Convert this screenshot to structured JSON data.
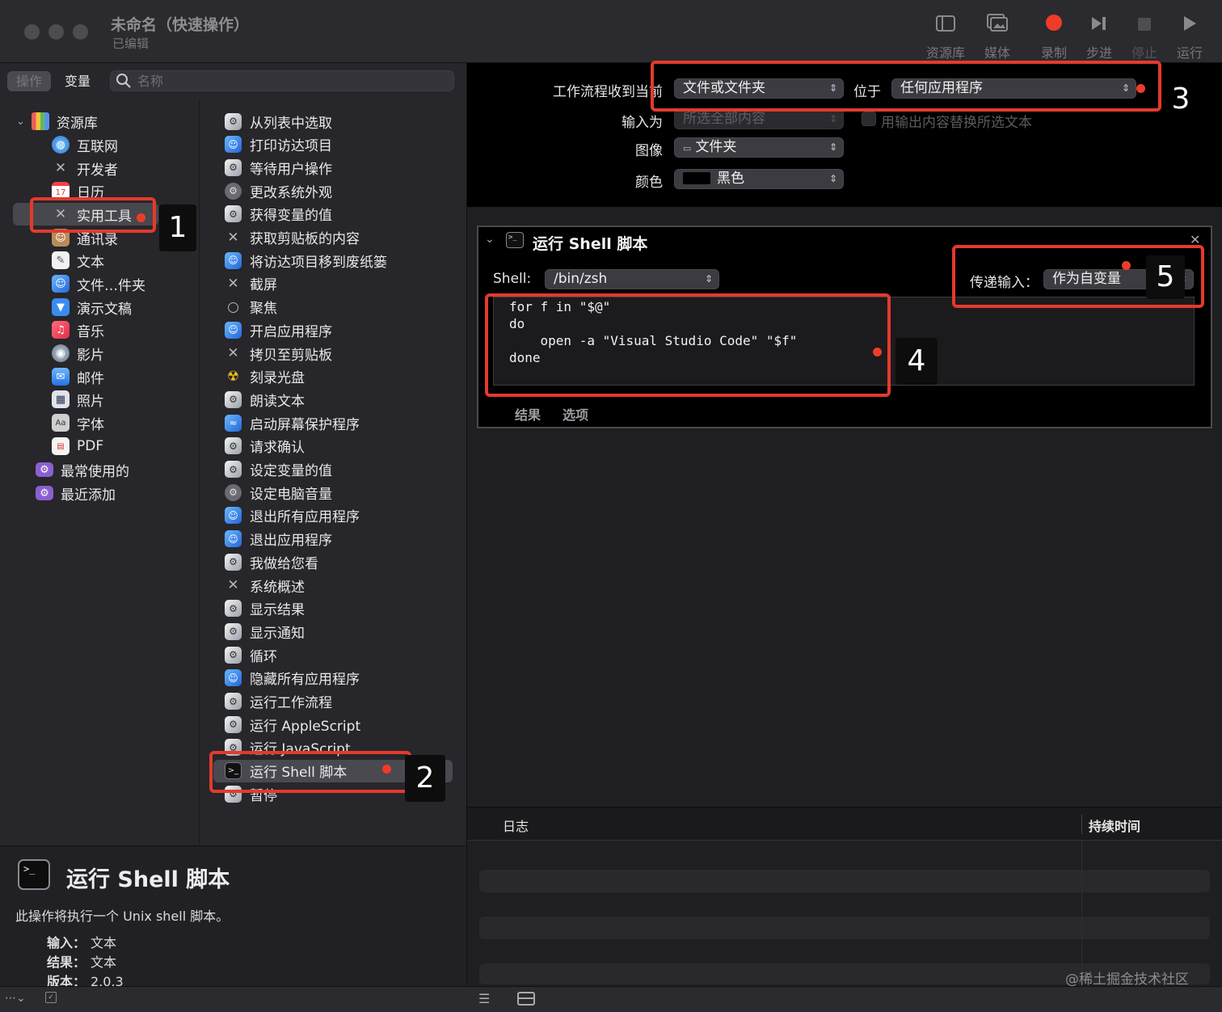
{
  "window": {
    "title": "未命名（快速操作）",
    "subtitle": "已编辑"
  },
  "toolbar": {
    "library": "资源库",
    "media": "媒体",
    "record": "录制",
    "step": "步进",
    "stop": "停止",
    "run": "运行"
  },
  "left": {
    "seg_actions": "操作",
    "seg_variables": "变量",
    "search_placeholder": "名称",
    "library": {
      "root": "资源库",
      "items": [
        "互联网",
        "开发者",
        "日历",
        "实用工具",
        "通讯录",
        "文本",
        "文件…件夹",
        "演示文稿",
        "音乐",
        "影片",
        "邮件",
        "照片",
        "字体",
        "PDF"
      ],
      "groups": [
        "最常使用的",
        "最近添加"
      ],
      "selected": "实用工具"
    },
    "actions": [
      "从列表中选取",
      "打印访达项目",
      "等待用户操作",
      "更改系统外观",
      "获得变量的值",
      "获取剪贴板的内容",
      "将访达项目移到废纸篓",
      "截屏",
      "聚焦",
      "开启应用程序",
      "拷贝至剪贴板",
      "刻录光盘",
      "朗读文本",
      "启动屏幕保护程序",
      "请求确认",
      "设定变量的值",
      "设定电脑音量",
      "退出所有应用程序",
      "退出应用程序",
      "我做给您看",
      "系统概述",
      "显示结果",
      "显示通知",
      "循环",
      "隐藏所有应用程序",
      "运行工作流程",
      "运行 AppleScript",
      "运行 JavaScript",
      "运行 Shell 脚本",
      "暂停"
    ],
    "selected_action": "运行 Shell 脚本"
  },
  "description": {
    "title": "运行 Shell 脚本",
    "text": "此操作将执行一个 Unix shell 脚本。",
    "input_label": "输入：",
    "input_value": "文本",
    "result_label": "结果：",
    "result_value": "文本",
    "version_label": "版本：",
    "version_value": "2.0.3"
  },
  "workflow": {
    "receives_label": "工作流程收到当前",
    "receives_value": "文件或文件夹",
    "in_label": "位于",
    "in_value": "任何应用程序",
    "input_is_label": "输入为",
    "input_is_value": "所选全部内容",
    "replace_label": "用输出内容替换所选文本",
    "image_label": "图像",
    "image_value": "文件夹",
    "color_label": "颜色",
    "color_value": "黑色"
  },
  "action_card": {
    "title": "运行 Shell 脚本",
    "shell_label": "Shell:",
    "shell_value": "/bin/zsh",
    "pass_input_label": "传递输入：",
    "pass_input_value": "作为自变量",
    "code": [
      "for f in \"$@\"",
      "do",
      "    open -a \"Visual Studio Code\" \"$f\"",
      "done"
    ],
    "tab_results": "结果",
    "tab_options": "选项"
  },
  "log": {
    "col_log": "日志",
    "col_duration": "持续时间"
  },
  "annotations": [
    "1",
    "2",
    "3",
    "4",
    "5"
  ],
  "watermark": "@稀土掘金技术社区",
  "colors": {
    "annotation_red": "#e33a2c",
    "record_red": "#ef3b2a"
  }
}
